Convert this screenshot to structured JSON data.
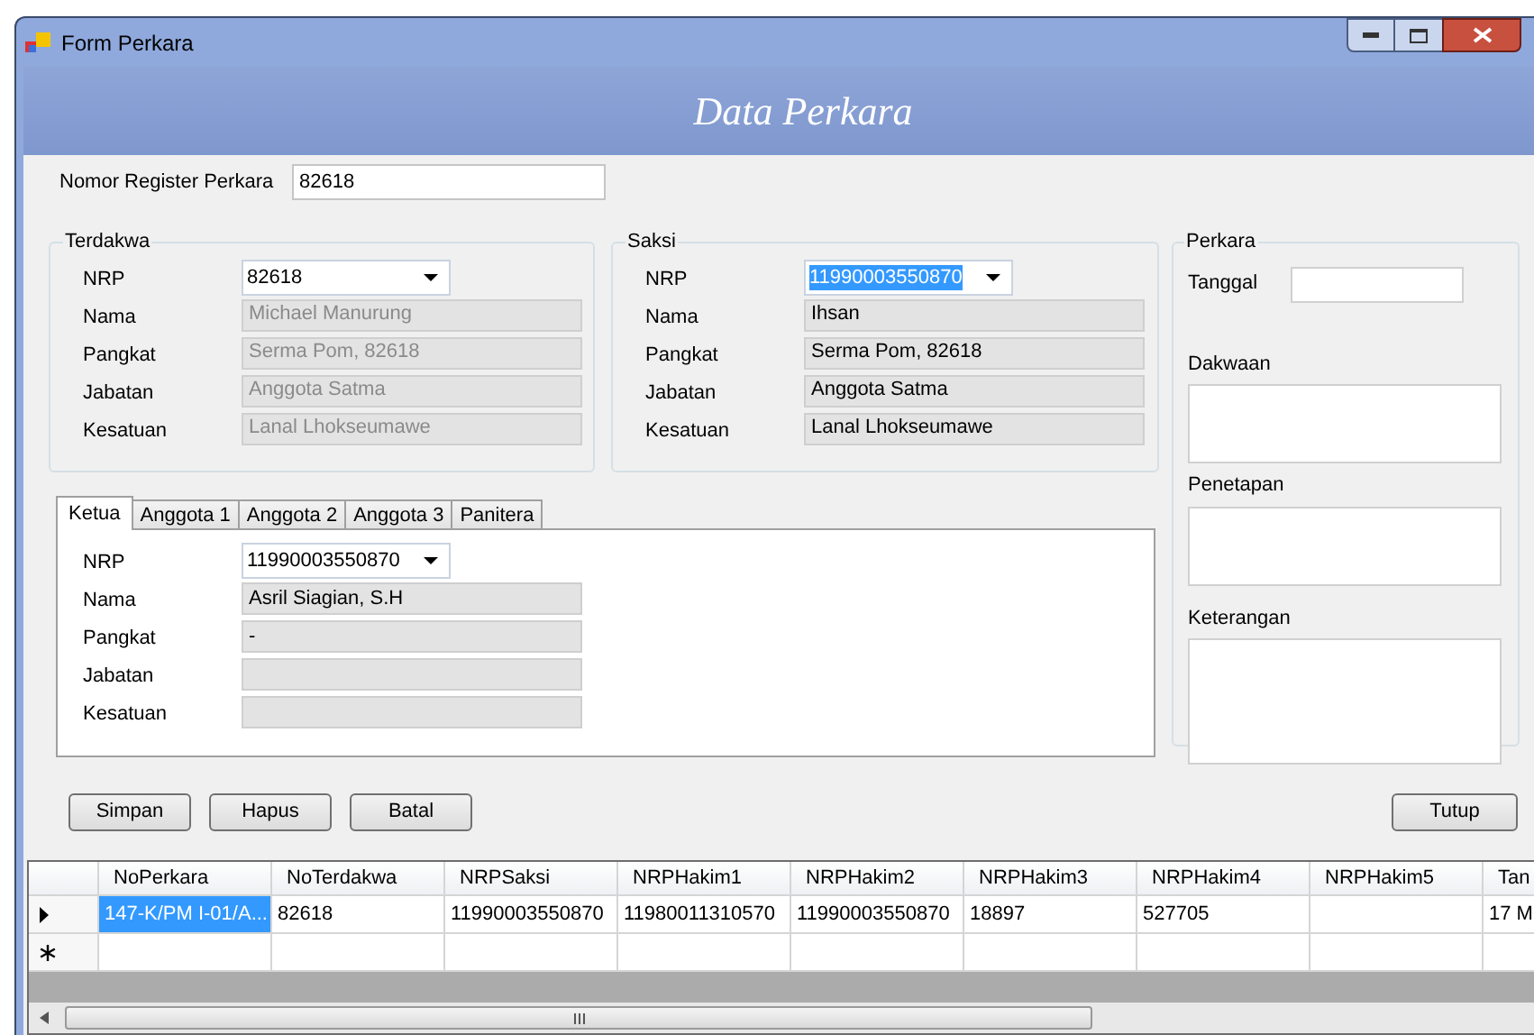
{
  "window": {
    "title": "Form Perkara"
  },
  "banner": {
    "title": "Data Perkara"
  },
  "register": {
    "label": "Nomor Register Perkara",
    "value": "82618"
  },
  "terdakwa": {
    "title": "Terdakwa",
    "fields": [
      {
        "label": "NRP",
        "kind": "combo",
        "value": "82618",
        "highlighted": false
      },
      {
        "label": "Nama",
        "kind": "readonly",
        "value": "Michael Manurung",
        "disabled": true
      },
      {
        "label": "Pangkat",
        "kind": "readonly",
        "value": "Serma Pom, 82618",
        "disabled": true
      },
      {
        "label": "Jabatan",
        "kind": "readonly",
        "value": "Anggota Satma",
        "disabled": true
      },
      {
        "label": "Kesatuan",
        "kind": "readonly",
        "value": "Lanal Lhokseumawe",
        "disabled": true
      }
    ]
  },
  "saksi": {
    "title": "Saksi",
    "fields": [
      {
        "label": "NRP",
        "kind": "combo",
        "value": "11990003550870",
        "highlighted": true
      },
      {
        "label": "Nama",
        "kind": "readonly",
        "value": "Ihsan",
        "disabled": false
      },
      {
        "label": "Pangkat",
        "kind": "readonly",
        "value": "Serma Pom, 82618",
        "disabled": false
      },
      {
        "label": "Jabatan",
        "kind": "readonly",
        "value": "Anggota Satma",
        "disabled": false
      },
      {
        "label": "Kesatuan",
        "kind": "readonly",
        "value": "Lanal Lhokseumawe",
        "disabled": false
      }
    ]
  },
  "perkara": {
    "title": "Perkara",
    "tanggal_label": "Tanggal",
    "areas": [
      "Dakwaan",
      "Penetapan",
      "Keterangan"
    ]
  },
  "tabs": [
    {
      "label": "Ketua",
      "selected": true
    },
    {
      "label": "Anggota 1",
      "selected": false
    },
    {
      "label": "Anggota 2",
      "selected": false
    },
    {
      "label": "Anggota 3",
      "selected": false
    },
    {
      "label": "Panitera",
      "selected": false
    }
  ],
  "hakim_fields": [
    {
      "label": "NRP",
      "kind": "combo",
      "value": "11990003550870",
      "highlighted": false
    },
    {
      "label": "Nama",
      "kind": "readonly",
      "value": "Asril Siagian, S.H",
      "disabled": false
    },
    {
      "label": "Pangkat",
      "kind": "readonly",
      "value": "-",
      "disabled": false
    },
    {
      "label": "Jabatan",
      "kind": "readonly"
    },
    {
      "label": "Kesatuan",
      "kind": "readonly"
    }
  ],
  "buttons": [
    "Simpan",
    "Hapus",
    "Batal"
  ],
  "close_button": "Tutup",
  "table": {
    "columns": [
      "NoPerkara",
      "NoTerdakwa",
      "NRPSaksi",
      "NRPHakim1",
      "NRPHakim2",
      "NRPHakim3",
      "NRPHakim4",
      "NRPHakim5",
      "Tan"
    ],
    "rows": [
      {
        "kind": "current",
        "cells": [
          {
            "text": "147-K/PM I-01/A...",
            "selected": true
          },
          {
            "text": "82618",
            "selected": false
          },
          {
            "text": "11990003550870",
            "selected": false
          },
          {
            "text": "11980011310570",
            "selected": false
          },
          {
            "text": "11990003550870",
            "selected": false
          },
          {
            "text": "18897",
            "selected": false
          },
          {
            "text": "527705",
            "selected": false
          },
          {
            "selected": false
          },
          {
            "text": "17 M",
            "selected": false
          }
        ]
      },
      {
        "kind": "new",
        "cells": []
      }
    ]
  }
}
